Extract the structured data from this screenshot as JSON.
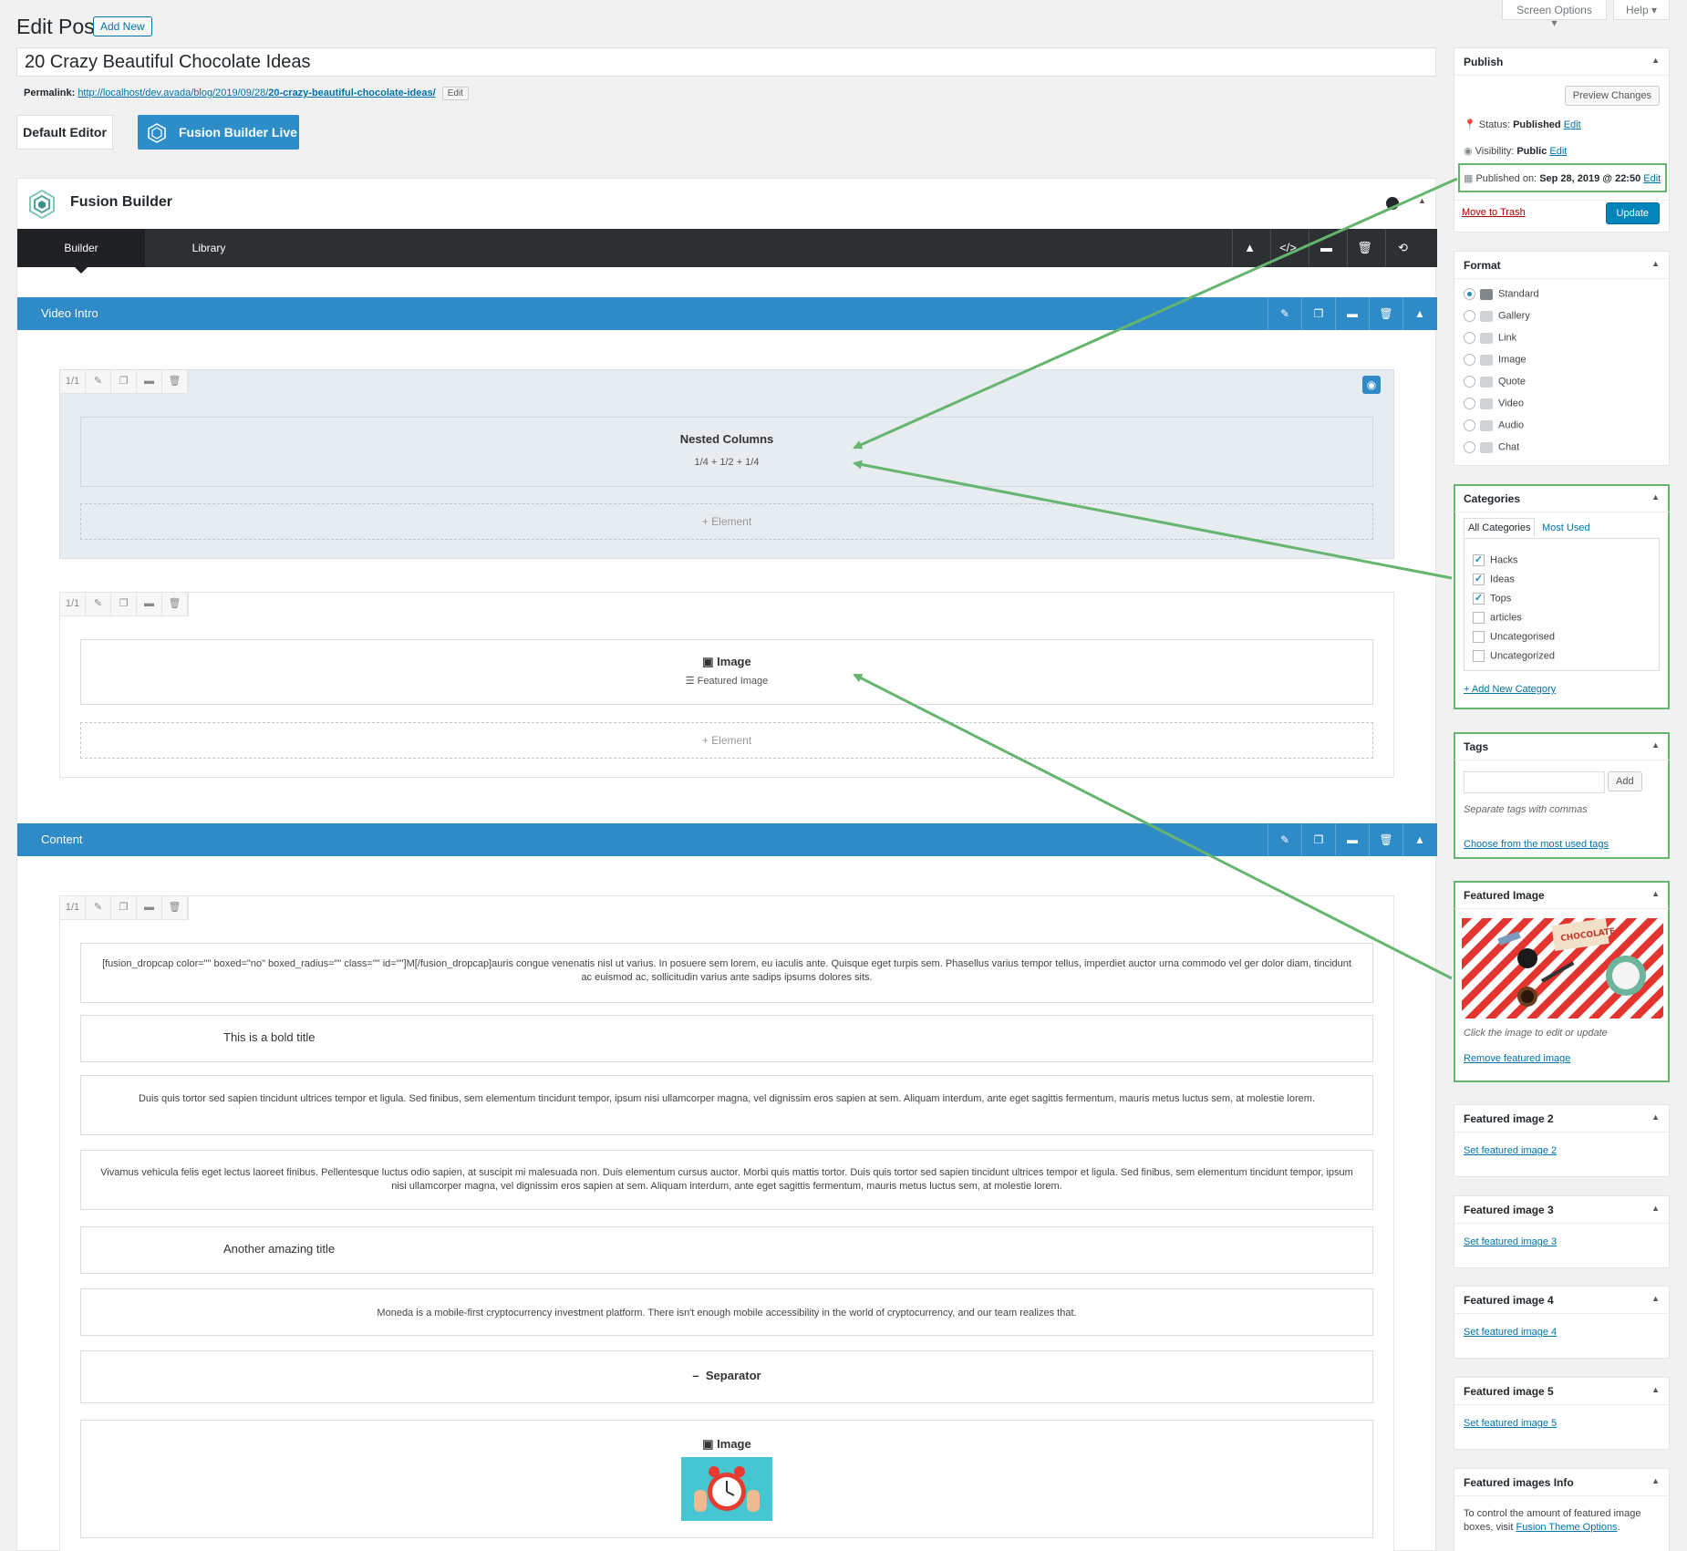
{
  "header": {
    "title": "Edit Post",
    "add_new": "Add New",
    "screen_options": "Screen Options ▾",
    "help": "Help ▾"
  },
  "post": {
    "title": "20 Crazy Beautiful Chocolate Ideas",
    "permalink_label": "Permalink:",
    "permalink_base": "http://localhost/dev.avada/blog/2019/09/28/",
    "permalink_slug": "20-crazy-beautiful-chocolate-ideas/",
    "permalink_edit": "Edit"
  },
  "editor_buttons": {
    "default": "Default Editor",
    "fusion_live": "Fusion Builder Live"
  },
  "builder": {
    "title": "Fusion Builder",
    "tabs": [
      "Builder",
      "Library"
    ],
    "sections": [
      {
        "label": "Video Intro"
      },
      {
        "label": "Content"
      }
    ],
    "column_fraction": "1/1",
    "add_element": "+ Element",
    "nested_columns": {
      "title": "Nested Columns",
      "sub": "1/4 + 1/2 + 1/4"
    },
    "image1": {
      "title": "Image",
      "sub": "Featured Image"
    },
    "content_blocks": {
      "dropcap": "[fusion_dropcap color=\"\" boxed=\"no\" boxed_radius=\"\" class=\"\" id=\"\"]M[/fusion_dropcap]auris congue venenatis nisl ut varius. In posuere sem lorem, eu iaculis ante. Quisque eget turpis sem. Phasellus varius tempor tellus, imperdiet auctor urna commodo vel ger dolor diam, tincidunt ac euismod ac, sollicitudin varius ante sadips ipsums dolores sits.",
      "bold_title": "This is a bold title",
      "para1": "Duis quis tortor sed sapien tincidunt ultrices tempor et ligula. Sed finibus, sem elementum tincidunt tempor, ipsum nisi ullamcorper magna, vel dignissim eros sapien at sem. Aliquam interdum, ante eget sagittis fermentum, mauris metus luctus sem, at molestie lorem.",
      "para2": "Vivamus vehicula felis eget lectus laoreet finibus. Pellentesque luctus odio sapien, at suscipit mi malesuada non. Duis elementum cursus auctor. Morbi quis mattis tortor. Duis quis tortor sed sapien tincidunt ultrices tempor et ligula. Sed finibus, sem elementum tincidunt tempor, ipsum nisi ullamcorper magna, vel dignissim eros sapien at sem. Aliquam interdum, ante eget sagittis fermentum, mauris metus luctus sem, at molestie lorem.",
      "amazing_title": "Another amazing title",
      "moneda": "Moneda is a mobile-first cryptocurrency investment platform. There isn't enough mobile accessibility in the world of cryptocurrency, and our team realizes that.",
      "separator": "Separator",
      "image2": "Image"
    }
  },
  "sidebar": {
    "publish": {
      "title": "Publish",
      "preview": "Preview Changes",
      "status_label": "Status:",
      "status_value": "Published",
      "visibility_label": "Visibility:",
      "visibility_value": "Public",
      "published_label": "Published on:",
      "published_value": "Sep 28, 2019 @ 22:50",
      "edit": "Edit",
      "trash": "Move to Trash",
      "update": "Update"
    },
    "format": {
      "title": "Format",
      "options": [
        "Standard",
        "Gallery",
        "Link",
        "Image",
        "Quote",
        "Video",
        "Audio",
        "Chat"
      ],
      "selected": "Standard"
    },
    "categories": {
      "title": "Categories",
      "tab_all": "All Categories",
      "tab_most": "Most Used",
      "items": [
        {
          "label": "Hacks",
          "checked": true
        },
        {
          "label": "Ideas",
          "checked": true
        },
        {
          "label": "Tops",
          "checked": true
        },
        {
          "label": "articles",
          "checked": false
        },
        {
          "label": "Uncategorised",
          "checked": false
        },
        {
          "label": "Uncategorized",
          "checked": false
        }
      ],
      "add_new": "+ Add New Category"
    },
    "tags": {
      "title": "Tags",
      "add": "Add",
      "hint": "Separate tags with commas",
      "choose": "Choose from the most used tags"
    },
    "featured_image": {
      "title": "Featured Image",
      "hint": "Click the image to edit or update",
      "remove": "Remove featured image",
      "stamp": "CHOCOLATE"
    },
    "featured_extra": [
      {
        "title": "Featured image 2",
        "link": "Set featured image 2"
      },
      {
        "title": "Featured image 3",
        "link": "Set featured image 3"
      },
      {
        "title": "Featured image 4",
        "link": "Set featured image 4"
      },
      {
        "title": "Featured image 5",
        "link": "Set featured image 5"
      }
    ],
    "featured_info": {
      "title": "Featured images Info",
      "text": "To control the amount of featured image boxes, visit",
      "link": "Fusion Theme Options"
    }
  },
  "colors": {
    "accent": "#2f8ac8",
    "annotation": "#65b56e",
    "bar": "#2d3033"
  }
}
